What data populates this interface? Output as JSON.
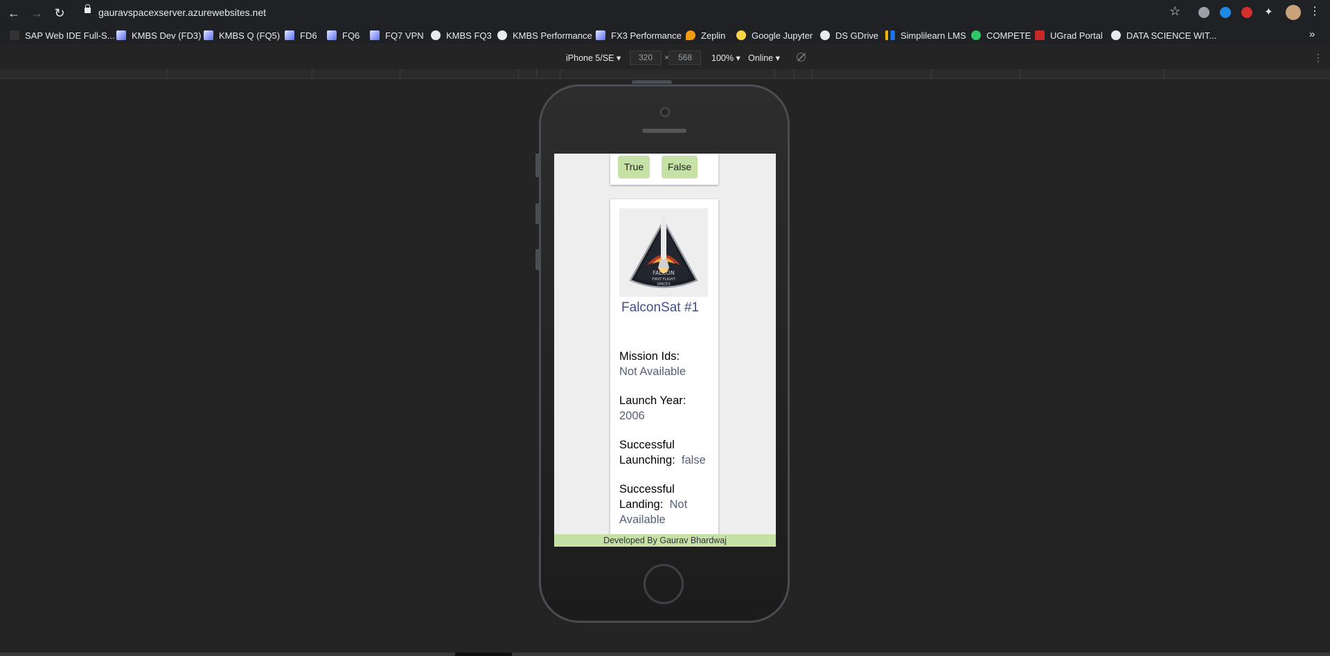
{
  "browser": {
    "url": "gauravspacexserver.azurewebsites.net",
    "bookmarks": [
      {
        "label": "SAP Web IDE Full-S...",
        "icon": "leaf-icon"
      },
      {
        "label": "KMBS Dev (FD3)",
        "icon": "page-icon"
      },
      {
        "label": "KMBS Q (FQ5)",
        "icon": "page-icon"
      },
      {
        "label": "FD6",
        "icon": "page-icon"
      },
      {
        "label": "FQ6",
        "icon": "page-icon"
      },
      {
        "label": "FQ7 VPN",
        "icon": "page-icon"
      },
      {
        "label": "KMBS FQ3",
        "icon": "globe-icon"
      },
      {
        "label": "KMBS Performance",
        "icon": "globe-icon"
      },
      {
        "label": "FX3 Performance",
        "icon": "page-icon"
      },
      {
        "label": "Zeplin",
        "icon": "zeplin-icon"
      },
      {
        "label": "Google Jupyter",
        "icon": "jupyter-icon"
      },
      {
        "label": "DS GDrive",
        "icon": "globe-icon"
      },
      {
        "label": "Simplilearn LMS",
        "icon": "simplilearn-icon"
      },
      {
        "label": "COMPETE",
        "icon": "h-icon"
      },
      {
        "label": "UGrad Portal",
        "icon": "ugrad-icon"
      },
      {
        "label": "DATA SCIENCE WIT...",
        "icon": "globe-icon"
      }
    ],
    "more_bookmarks": "»"
  },
  "device_toolbar": {
    "device": "iPhone 5/SE",
    "width": "320",
    "times": "×",
    "height": "568",
    "zoom": "100%",
    "network": "Online"
  },
  "app": {
    "filter_buttons": [
      "True",
      "False"
    ],
    "launch": {
      "mission_name": "FalconSat #1",
      "patch_text": [
        "FALCON",
        "FIRST FLIGHT",
        "SPACEX"
      ],
      "fields": [
        {
          "label": "Mission Ids:",
          "value": "Not Available"
        },
        {
          "label": "Launch Year:",
          "value": "2006"
        },
        {
          "label": "Successful Launching:",
          "value": "false"
        },
        {
          "label": "Successful Landing:",
          "value": "Not Available"
        }
      ]
    },
    "footer": "Developed By Gaurav Bhardwaj"
  },
  "colors": {
    "accent_green": "#c5e1a5",
    "mission_title": "#3f4d8c",
    "browser_bg": "#202124",
    "page_bg": "#eeeeee"
  }
}
